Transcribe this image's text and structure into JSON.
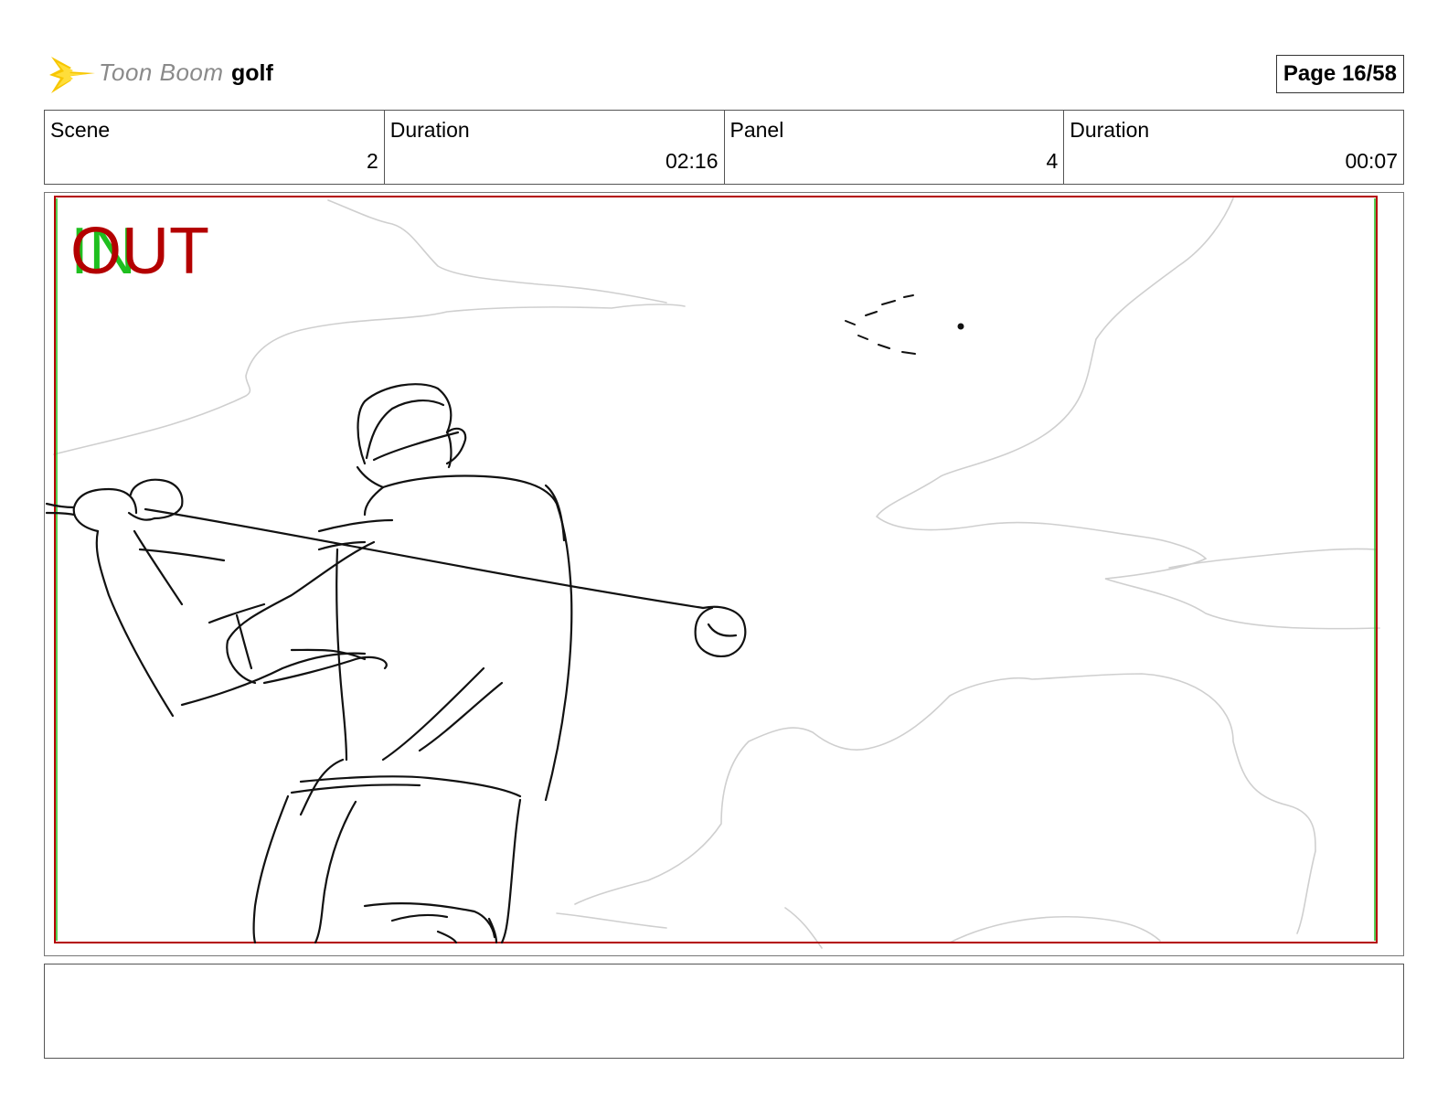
{
  "header": {
    "logo_text": "Toon Boom",
    "project_name": "golf",
    "page_label": "Page 16/58"
  },
  "info": {
    "scene_label": "Scene",
    "scene_value": "2",
    "scene_duration_label": "Duration",
    "scene_duration_value": "02:16",
    "panel_label": "Panel",
    "panel_value": "4",
    "panel_duration_label": "Duration",
    "panel_duration_value": "00:07"
  },
  "panel": {
    "in_marker": "IN",
    "out_marker": "OUT"
  },
  "notes": {
    "text": ""
  },
  "colors": {
    "safe_frame_red": "#b40000",
    "safe_frame_green": "#1fbf1f",
    "sketch": "#000000",
    "clouds": "#cfcfcf"
  }
}
